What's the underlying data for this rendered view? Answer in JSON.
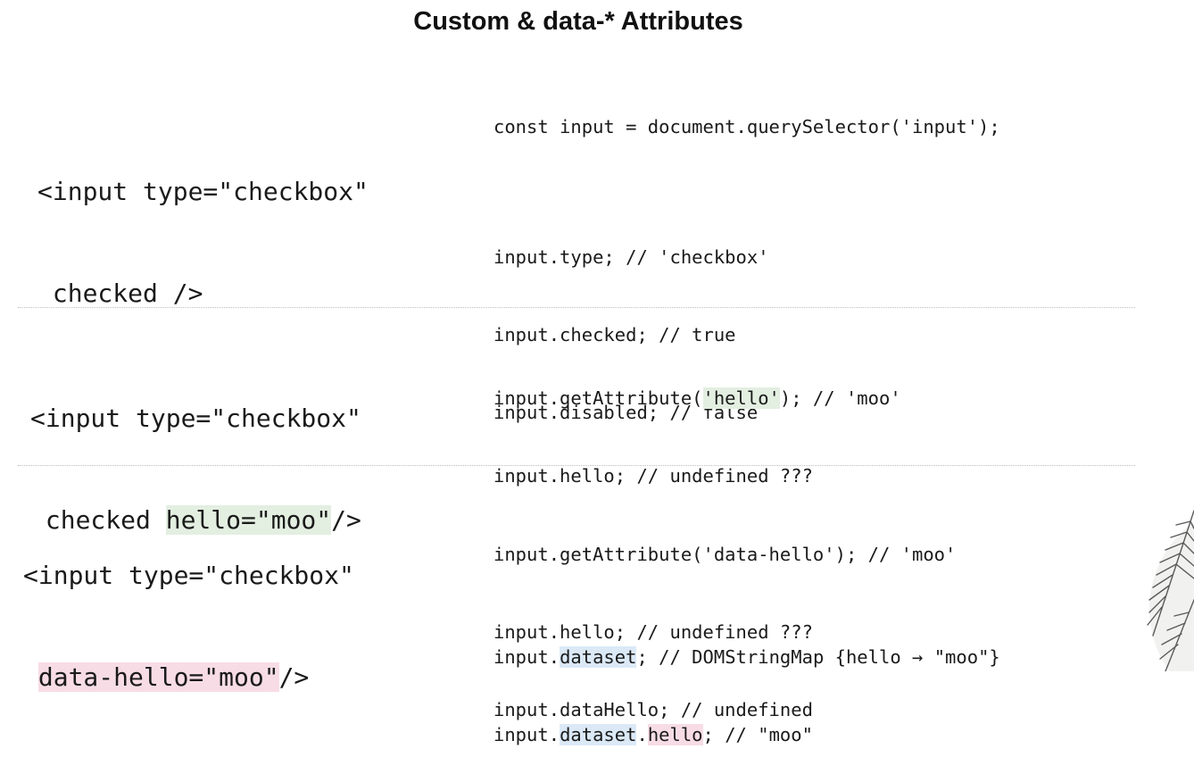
{
  "slide": {
    "title": "Custom & data-* Attributes"
  },
  "section1": {
    "html_line1": "<input type=\"checkbox\"",
    "html_line2": " checked />",
    "js_query": "const input = document.querySelector('input');",
    "js_lines": [
      "input.type; // 'checkbox'",
      "input.checked; // true",
      "input.disabled; // false"
    ]
  },
  "section2": {
    "html_line1": "<input type=\"checkbox\"",
    "html_line2_pre": " checked ",
    "html_line2_hl": "hello=\"moo\"",
    "html_line2_post": "/>",
    "js1_pre": "input.getAttribute(",
    "js1_hl": "'hello'",
    "js1_post": "); // 'moo'",
    "js2": "input.hello; // undefined ???"
  },
  "section3": {
    "html_line1": "<input type=\"checkbox\"",
    "html_line2_pre": " ",
    "html_line2_hl": "data-hello=\"moo\"",
    "html_line2_post": "/>",
    "js_lines": [
      "input.getAttribute('data-hello'); // 'moo'",
      "input.hello; // undefined ???",
      "input.dataHello; // undefined"
    ],
    "ds1_pre": "input.",
    "ds1_hl": "dataset",
    "ds1_post": "; // DOMStringMap {hello → \"moo\"}",
    "ds2_pre": "input.",
    "ds2_hl1": "dataset",
    "ds2_dot": ".",
    "ds2_hl2": "hello",
    "ds2_post": "; // \"moo\""
  },
  "colors": {
    "highlight_green": "#e3efe1",
    "highlight_pink": "#f7dce6",
    "highlight_blue": "#dbe9f7"
  },
  "icons": {
    "corner_decoration": "palm-leaf-decoration"
  }
}
